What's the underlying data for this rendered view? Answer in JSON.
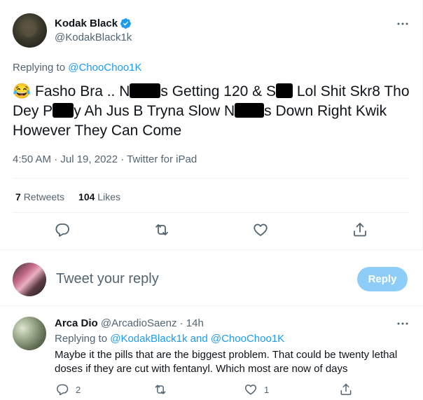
{
  "main_tweet": {
    "display_name": "Kodak Black",
    "handle": "@KodakBlack1k",
    "replying_prefix": "Replying to",
    "replying_to": "@ChooChoo1K",
    "text": {
      "emoji": "😂",
      "p1": "Fasho Bra .. N",
      "p2": "s Getting 120 & S",
      "p3": " Lol Shit Skr8 Tho Dey P",
      "p4": "y Ah Jus B Tryna Slow N",
      "p5": "s Down Right Kwik However They Can Come"
    },
    "timestamp": "4:50 AM · Jul 19, 2022 · Twitter for iPad",
    "retweets_count": "7",
    "retweets_label": "Retweets",
    "likes_count": "104",
    "likes_label": "Likes"
  },
  "reply_box": {
    "placeholder": "Tweet your reply",
    "button_label": "Reply"
  },
  "reply_tweet": {
    "display_name": "Arca Dio",
    "handle_time": "@ArcadioSaenz · 14h",
    "replying_prefix": "Replying to",
    "mention1": "@KodakBlack1k",
    "and": "and",
    "mention2": "@ChooChoo1K",
    "text": "Maybe it the pills that are the biggest problem. That could be twenty lethal doses if they are cut with fentanyl. Which most are now of days",
    "reply_count": "2",
    "like_count": "1"
  },
  "colors": {
    "accent": "#1d9bf0",
    "muted": "#536471",
    "text": "#0f1419",
    "reply_button": "#8ecdf8"
  },
  "icons": [
    "verified-badge-icon",
    "more-icon",
    "reply-icon",
    "retweet-icon",
    "like-icon",
    "share-icon"
  ]
}
